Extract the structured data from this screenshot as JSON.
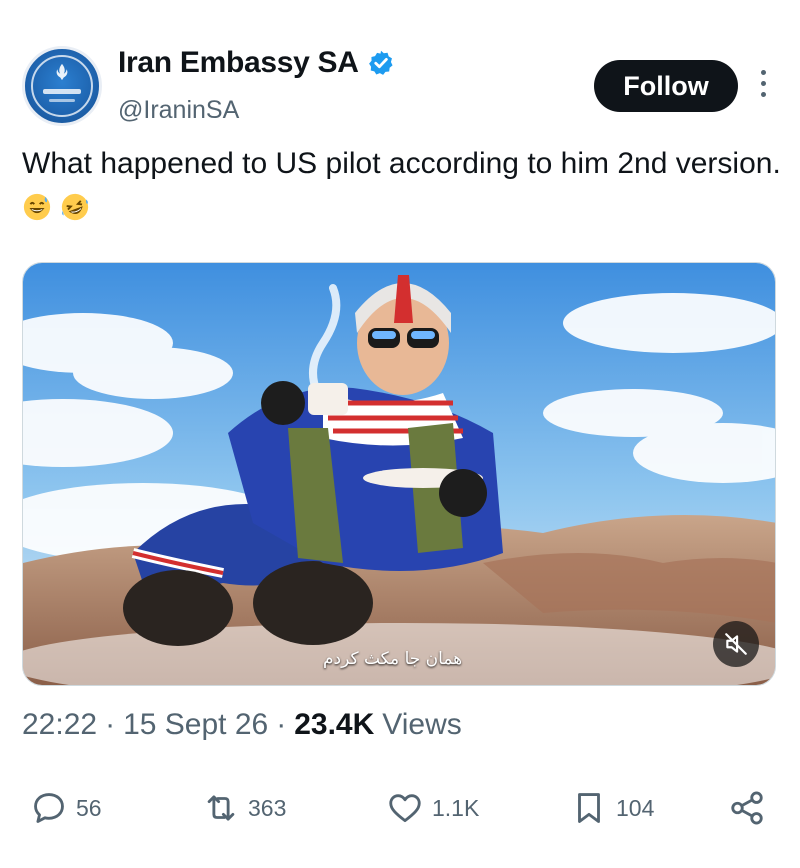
{
  "author": {
    "display_name": "Iran Embassy SA",
    "handle": "@IraninSA",
    "verified": true,
    "avatar_icon": "embassy-seal-icon"
  },
  "follow_label": "Follow",
  "tweet": {
    "text": "What happened to US pilot according to him 2nd version.",
    "emojis": [
      "grinning-sweat-emoji",
      "rolling-laughing-emoji"
    ]
  },
  "media": {
    "caption": "همان جا مکث کردم",
    "mute_icon": "muted-speaker-icon"
  },
  "meta": {
    "time": "22:22",
    "date": "15 Sept 26",
    "views_count": "23.4K",
    "views_label": "Views"
  },
  "actions": {
    "replies": "56",
    "reposts": "363",
    "likes": "1.1K",
    "bookmarks": "104"
  },
  "colors": {
    "text_primary": "#0f1419",
    "text_secondary": "#536471",
    "verified_blue": "#1d9bf0",
    "follow_bg": "#0f1419"
  }
}
